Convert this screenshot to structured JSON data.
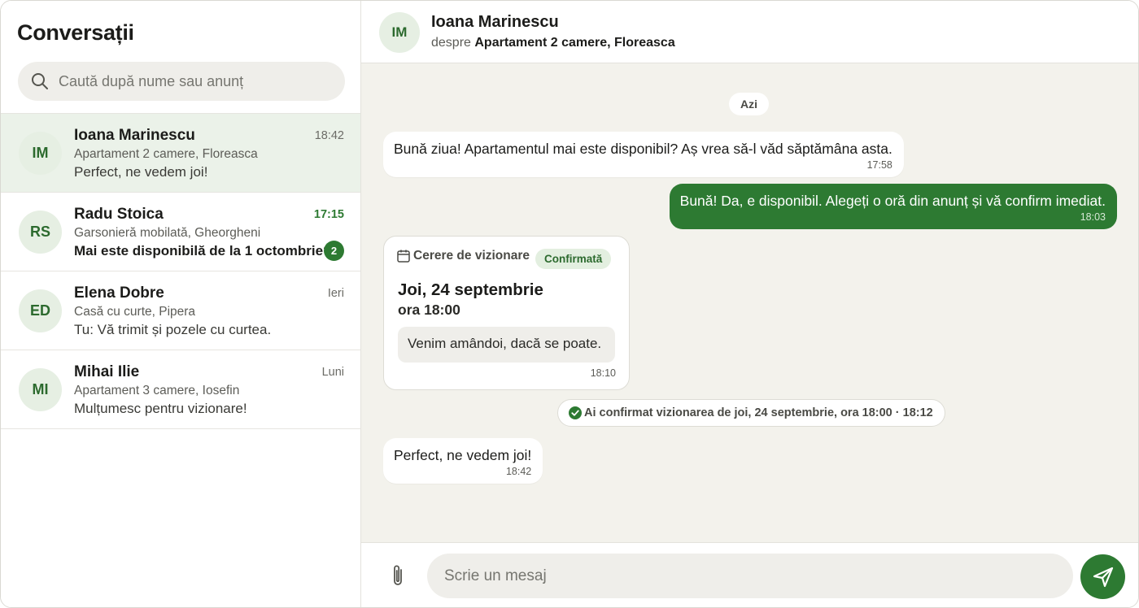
{
  "sidebar": {
    "title": "Conversații",
    "search_placeholder": "Caută după nume sau anunț",
    "conversations": [
      {
        "initials": "IM",
        "name": "Ioana Marinescu",
        "listing": "Apartament 2 camere, Floreasca",
        "preview": "Perfect, ne vedem joi!",
        "time": "18:42",
        "unread": 0,
        "active": true
      },
      {
        "initials": "RS",
        "name": "Radu Stoica",
        "listing": "Garsonieră mobilată, Gheorgheni",
        "preview": "Mai este disponibilă de la 1 octombrie?",
        "time": "17:15",
        "unread": "2",
        "active": false
      },
      {
        "initials": "ED",
        "name": "Elena Dobre",
        "listing": "Casă cu curte, Pipera",
        "preview": "Tu: Vă trimit și pozele cu curtea.",
        "time": "Ieri",
        "unread": 0,
        "active": false
      },
      {
        "initials": "MI",
        "name": "Mihai Ilie",
        "listing": "Apartament 3 camere, Iosefin",
        "preview": "Mulțumesc pentru vizionare!",
        "time": "Luni",
        "unread": 0,
        "active": false
      }
    ]
  },
  "header": {
    "initials": "IM",
    "name": "Ioana Marinescu",
    "about_prefix": "despre",
    "about_listing": "Apartament 2 camere, Floreasca"
  },
  "chat": {
    "day": "Azi",
    "messages": [
      {
        "text": "Bună ziua! Apartamentul mai este disponibil? Aș vrea să-l văd săptămâna asta.",
        "time": "17:58"
      },
      {
        "text": "Bună! Da, e disponibil. Alegeți o oră din anunț și vă confirm imediat.",
        "time": "18:03"
      }
    ],
    "viewing_card": {
      "label": "Cerere de vizionare",
      "status": "Confirmată",
      "date": "Joi, 24 septembrie",
      "hour": "ora 18:00",
      "note": "Venim amândoi, dacă se poate.",
      "time": "18:10"
    },
    "system_note": "Ai confirmat vizionarea de joi, 24 septembrie, ora 18:00 · 18:12",
    "last_message": {
      "text": "Perfect, ne vedem joi!",
      "time": "18:42"
    }
  },
  "composer": {
    "placeholder": "Scrie un mesaj"
  },
  "colors": {
    "accent": "#2d7a32",
    "active_row": "#ebf2e9",
    "chat_bg": "#f3f2ec"
  }
}
